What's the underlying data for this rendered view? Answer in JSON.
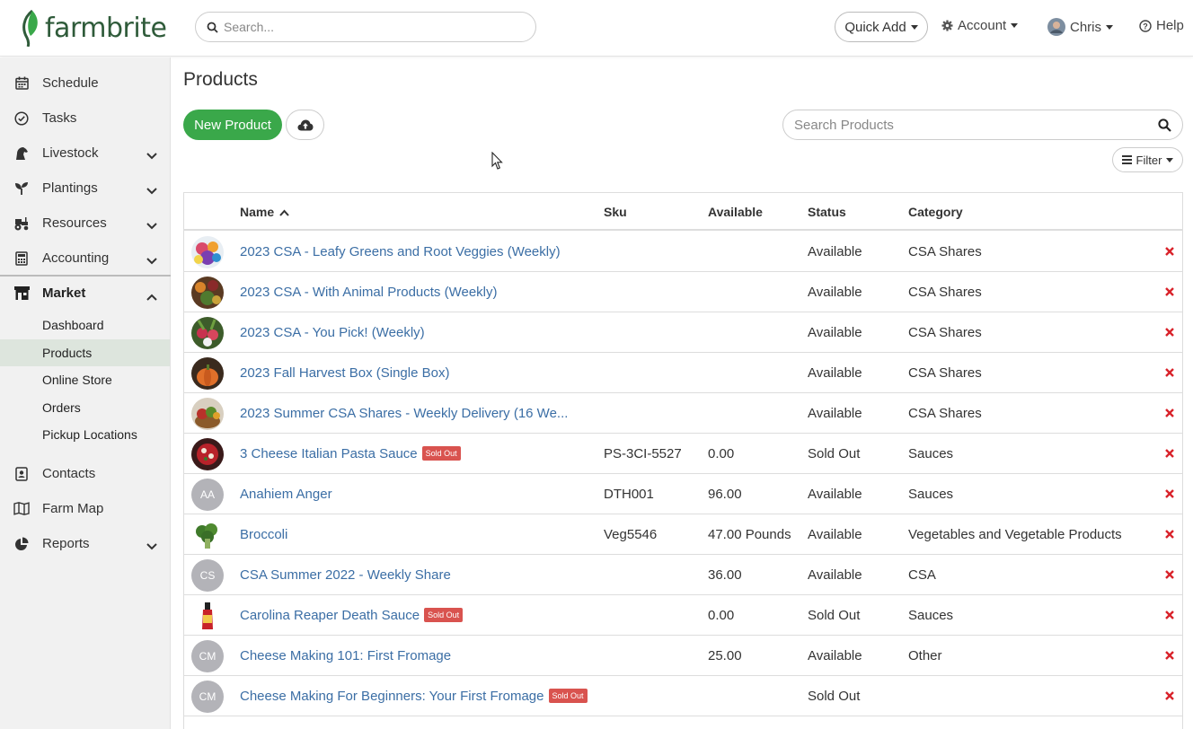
{
  "header": {
    "logo_text": "farmbrite",
    "search_placeholder": "Search...",
    "quick_add_label": "Quick Add",
    "account_label": "Account",
    "user_label": "Chris",
    "help_label": "Help",
    "brand_color": "#3aa84a"
  },
  "sidebar": {
    "items": [
      {
        "label": "Schedule",
        "icon": "calendar-icon"
      },
      {
        "label": "Tasks",
        "icon": "check-circle-icon"
      },
      {
        "label": "Livestock",
        "icon": "horse-icon"
      },
      {
        "label": "Plantings",
        "icon": "seedling-icon"
      },
      {
        "label": "Resources",
        "icon": "tractor-icon"
      },
      {
        "label": "Accounting",
        "icon": "calculator-icon"
      },
      {
        "label": "Market",
        "icon": "store-icon"
      },
      {
        "label": "Contacts",
        "icon": "address-book-icon"
      },
      {
        "label": "Farm Map",
        "icon": "map-icon"
      },
      {
        "label": "Reports",
        "icon": "pie-chart-icon"
      }
    ],
    "market_sub": [
      "Dashboard",
      "Products",
      "Online Store",
      "Orders",
      "Pickup Locations"
    ],
    "active_sub": "Products"
  },
  "main": {
    "title": "Products",
    "new_product_label": "New Product",
    "search_placeholder": "Search Products",
    "filter_label": "Filter"
  },
  "table": {
    "columns": [
      "Name",
      "Sku",
      "Available",
      "Status",
      "Category"
    ],
    "rows": [
      {
        "name": "2023 CSA - Leafy Greens and Root Veggies (Weekly)",
        "sku": "",
        "available": "",
        "status": "Available",
        "category": "CSA Shares",
        "badge": "",
        "avatar": "",
        "image": "tomatoes"
      },
      {
        "name": "2023 CSA - With Animal Products (Weekly)",
        "sku": "",
        "available": "",
        "status": "Available",
        "category": "CSA Shares",
        "badge": "",
        "avatar": "",
        "image": "veggies"
      },
      {
        "name": "2023 CSA - You Pick! (Weekly)",
        "sku": "",
        "available": "",
        "status": "Available",
        "category": "CSA Shares",
        "badge": "",
        "avatar": "",
        "image": "radishes"
      },
      {
        "name": "2023 Fall Harvest Box (Single Box)",
        "sku": "",
        "available": "",
        "status": "Available",
        "category": "CSA Shares",
        "badge": "",
        "avatar": "",
        "image": "pumpkins"
      },
      {
        "name": "2023 Summer CSA Shares - Weekly Delivery (16 We...",
        "sku": "",
        "available": "",
        "status": "Available",
        "category": "CSA Shares",
        "badge": "",
        "avatar": "",
        "image": "basket"
      },
      {
        "name": "3 Cheese Italian Pasta Sauce",
        "sku": "PS-3CI-5527",
        "available": "0.00",
        "status": "Sold Out",
        "category": "Sauces",
        "badge": "Sold Out",
        "avatar": "",
        "image": "sauce"
      },
      {
        "name": "Anahiem Anger",
        "sku": "DTH001",
        "available": "96.00",
        "status": "Available",
        "category": "Sauces",
        "badge": "",
        "avatar": "AA",
        "image": ""
      },
      {
        "name": "Broccoli",
        "sku": "Veg5546",
        "available": "47.00 Pounds",
        "status": "Available",
        "category": "Vegetables and Vegetable Products",
        "badge": "",
        "avatar": "",
        "image": "broccoli"
      },
      {
        "name": "CSA Summer 2022 - Weekly Share",
        "sku": "",
        "available": "36.00",
        "status": "Available",
        "category": "CSA",
        "badge": "",
        "avatar": "CS",
        "image": ""
      },
      {
        "name": "Carolina Reaper Death Sauce",
        "sku": "",
        "available": "0.00",
        "status": "Sold Out",
        "category": "Sauces",
        "badge": "Sold Out",
        "avatar": "",
        "image": "hot-sauce"
      },
      {
        "name": "Cheese Making 101: First Fromage",
        "sku": "",
        "available": "25.00",
        "status": "Available",
        "category": "Other",
        "badge": "",
        "avatar": "CM",
        "image": ""
      },
      {
        "name": "Cheese Making For Beginners: Your First Fromage",
        "sku": "",
        "available": "",
        "status": "Sold Out",
        "category": "",
        "badge": "Sold Out",
        "avatar": "CM",
        "image": ""
      }
    ]
  }
}
